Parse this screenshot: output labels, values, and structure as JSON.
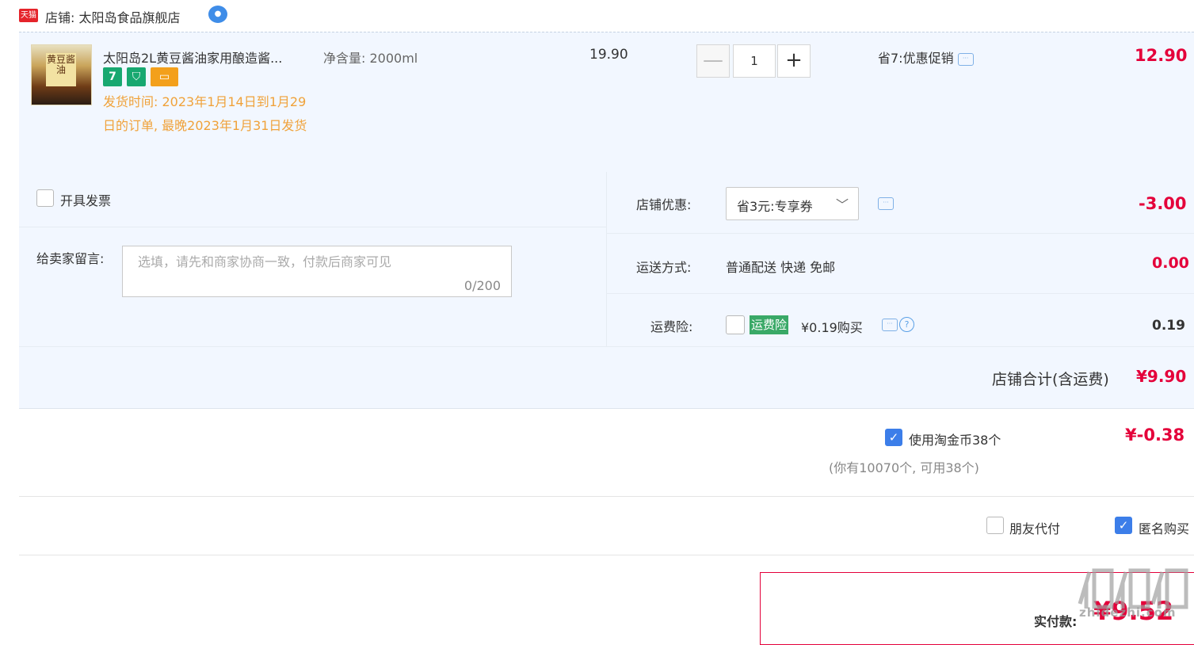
{
  "shop": {
    "platform_badge": "天猫",
    "name": "店铺: 太阳岛食品旗舰店",
    "wangwang_icon": "wangwang-chat-icon"
  },
  "item": {
    "thumb_label": "黄豆酱油",
    "title": "太阳岛2L黄豆酱油家用酿造酱...",
    "badges": [
      "7",
      "bag",
      "card"
    ],
    "ship_time": "发货时间: 2023年1月14日到1月29日的订单, 最晚2023年1月31日发货",
    "spec": "净含量: 2000ml",
    "unit_price": "19.90",
    "quantity": "1",
    "minus": "—",
    "plus": "+",
    "promo": "省7:优惠促销",
    "amount": "12.90"
  },
  "options": {
    "invoice_label": "开具发票",
    "message_label": "给卖家留言:",
    "message_placeholder": "选填，请先和商家协商一致，付款后商家可见",
    "message_count": "0/200",
    "shop_discount_label": "店铺优惠:",
    "shop_discount_value": "省3元:专享券",
    "shop_discount_amount": "-3.00",
    "delivery_label": "运送方式:",
    "delivery_value": "普通配送 快递 免邮",
    "delivery_amount": "0.00",
    "insurance_label": "运费险:",
    "insurance_tag": "运费险",
    "insurance_price": "¥0.19购买",
    "insurance_amount": "0.19",
    "shop_total_label": "店铺合计(含运费)",
    "shop_total_value": "¥9.90"
  },
  "coins": {
    "label": "使用淘金币38个",
    "amount": "¥-0.38",
    "note": "(你有10070个, 可用38个)",
    "checked": true
  },
  "extras": {
    "friend_pay_label": "朋友代付",
    "anonymous_label": "匿名购买",
    "anonymous_checked": true
  },
  "payment": {
    "label": "实付款:",
    "value": "¥9.52"
  },
  "watermark": "zhidezhi.com",
  "colors": {
    "price_red": "#e4003a",
    "ship_time_orange": "#f0a23a",
    "row_bg": "#f2f7ff",
    "checkbox_blue": "#3c7ee9",
    "insurance_green": "#3aa967"
  }
}
